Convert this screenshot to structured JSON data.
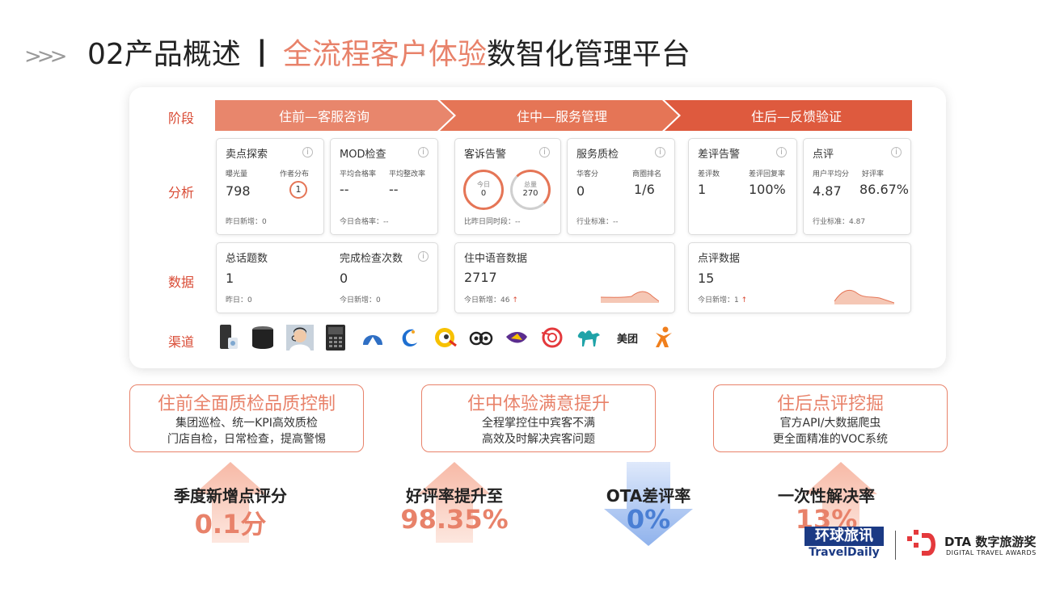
{
  "header": {
    "prefix": "02产品概述",
    "separator": "丨",
    "accent": "全流程客户体验",
    "rest": "数智化管理平台"
  },
  "row_labels": {
    "stage": "阶段",
    "analysis": "分析",
    "data": "数据",
    "channel": "渠道"
  },
  "stages": [
    "住前—客服咨询",
    "住中—服务管理",
    "住后—反馈验证"
  ],
  "cards": {
    "selling": {
      "title": "卖点探索",
      "l1": "曝光量",
      "l2": "作者分布",
      "v1": "798",
      "v2": "1",
      "foot": "昨日新增：0"
    },
    "mod": {
      "title": "MOD检查",
      "l1": "平均合格率",
      "l2": "平均整改率",
      "v1": "--",
      "v2": "--",
      "foot": "今日合格率：--"
    },
    "complaint": {
      "title": "客诉告警",
      "today_label": "今日",
      "today_val": "0",
      "total_label": "总量",
      "total_val": "270",
      "foot": "比昨日同时段：--"
    },
    "service": {
      "title": "服务质检",
      "l1": "华客分",
      "l2": "商圈排名",
      "v1": "0",
      "v2": "1/6",
      "foot": "行业标准：--"
    },
    "negative": {
      "title": "差评告警",
      "l1": "差评数",
      "l2": "差评回复率",
      "v1": "1",
      "v2": "100%"
    },
    "review": {
      "title": "点评",
      "l1": "用户平均分",
      "l2": "好评率",
      "v1": "4.87",
      "v2": "86.67%",
      "foot": "行业标准：4.87"
    },
    "topics": {
      "t1": "总话题数",
      "t2": "完成检查次数",
      "v1": "1",
      "v2": "0",
      "f1": "昨日：0",
      "f2": "今日新增：0"
    },
    "voice": {
      "title": "住中语音数据",
      "value": "2717",
      "foot": "今日新增：46"
    },
    "reviewdata": {
      "title": "点评数据",
      "value": "15",
      "foot": "今日新增：1"
    }
  },
  "channels": [
    "phone-icon",
    "speaker-icon",
    "agent-avatar",
    "desk-phone-icon",
    "ctrip-icon",
    "elong-icon",
    "qunar-icon",
    "tripadvisor-icon",
    "tujia-icon",
    "fliggy-icon",
    "camel-icon",
    "meituan-logo",
    "person-icon"
  ],
  "meituan_label": "美团",
  "features": [
    {
      "title": "住前全面质检品质控制",
      "l1": "集团巡检、统一KPI高效质检",
      "l2": "门店自检，日常检查，提高警惕"
    },
    {
      "title": "住中体验满意提升",
      "l1": "全程掌控住中宾客不满",
      "l2": "高效及时解决宾客问题"
    },
    {
      "title": "住后点评挖掘",
      "l1": "官方API/大数据爬虫",
      "l2": "更全面精准的VOC系统"
    }
  ],
  "kpis": [
    {
      "label": "季度新增点评分",
      "value": "0.1分",
      "dir": "up"
    },
    {
      "label": "好评率提升至",
      "value": "98.35%",
      "dir": "up"
    },
    {
      "label": "OTA差评率",
      "value": "0%",
      "dir": "down"
    },
    {
      "label": "一次性解决率",
      "value": "13%",
      "dir": "up"
    }
  ],
  "logos": {
    "tdcn": "环球旅讯",
    "td": "TravelDaily",
    "dta_main": "DTA 数字旅游奖",
    "dta_sub": "DIGITAL TRAVEL AWARDS"
  },
  "colors": {
    "accent": "#e8826a",
    "red": "#d94b35",
    "blue": "#4a7fd4"
  }
}
